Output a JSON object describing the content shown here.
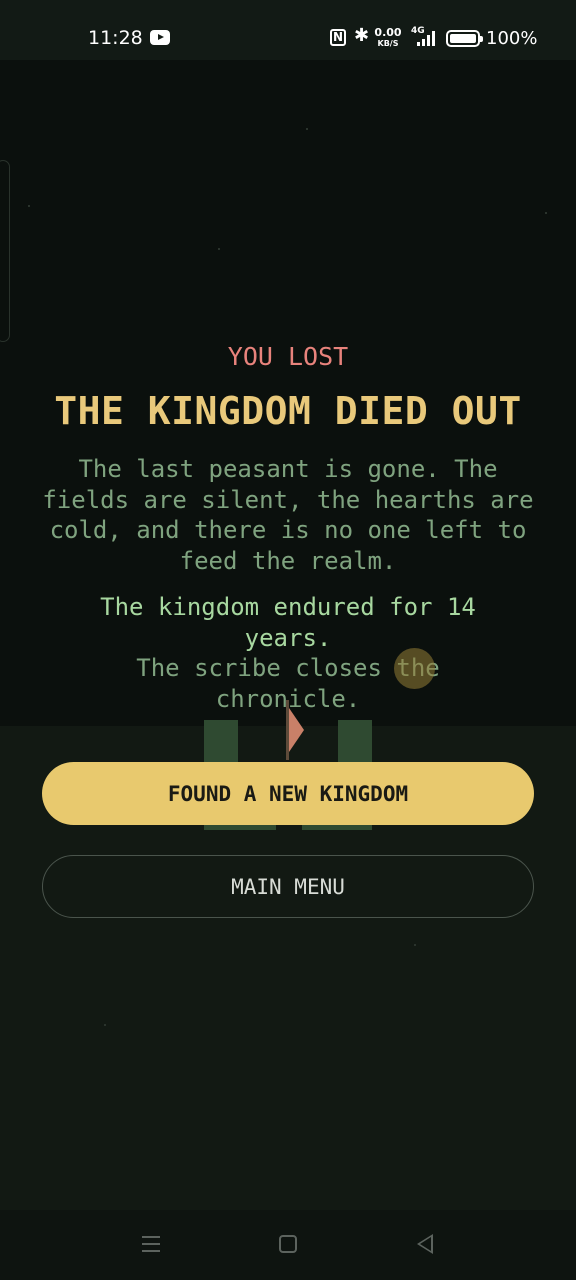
{
  "status_bar": {
    "time": "11:28",
    "net_speed": "0.00",
    "net_unit": "KB/S",
    "signal_label": "4G",
    "battery": "100%",
    "icons": [
      "youtube-icon",
      "nfc-icon",
      "bluetooth-icon",
      "signal-icon",
      "battery-icon"
    ]
  },
  "game_over": {
    "outcome": "YOU LOST",
    "title": "THE KINGDOM DIED OUT",
    "description": "The last peasant is gone. The fields are silent, the hearths are cold, and there is no one left to feed the realm.",
    "endured": "The kingdom endured for 14 years.",
    "scribe": "The scribe closes the chronicle.",
    "years_endured": 14
  },
  "buttons": {
    "found_new_kingdom": "FOUND A NEW KINGDOM",
    "main_menu": "MAIN MENU"
  },
  "nav": {
    "icons": [
      "recent-apps-icon",
      "home-icon",
      "back-icon"
    ]
  },
  "colors": {
    "background": "#0b100d",
    "outcome": "#e8837c",
    "title": "#e9c97b",
    "body_text": "#7fa37f",
    "highlight_text": "#a8d8a0",
    "primary_button": "#e8c96e"
  }
}
